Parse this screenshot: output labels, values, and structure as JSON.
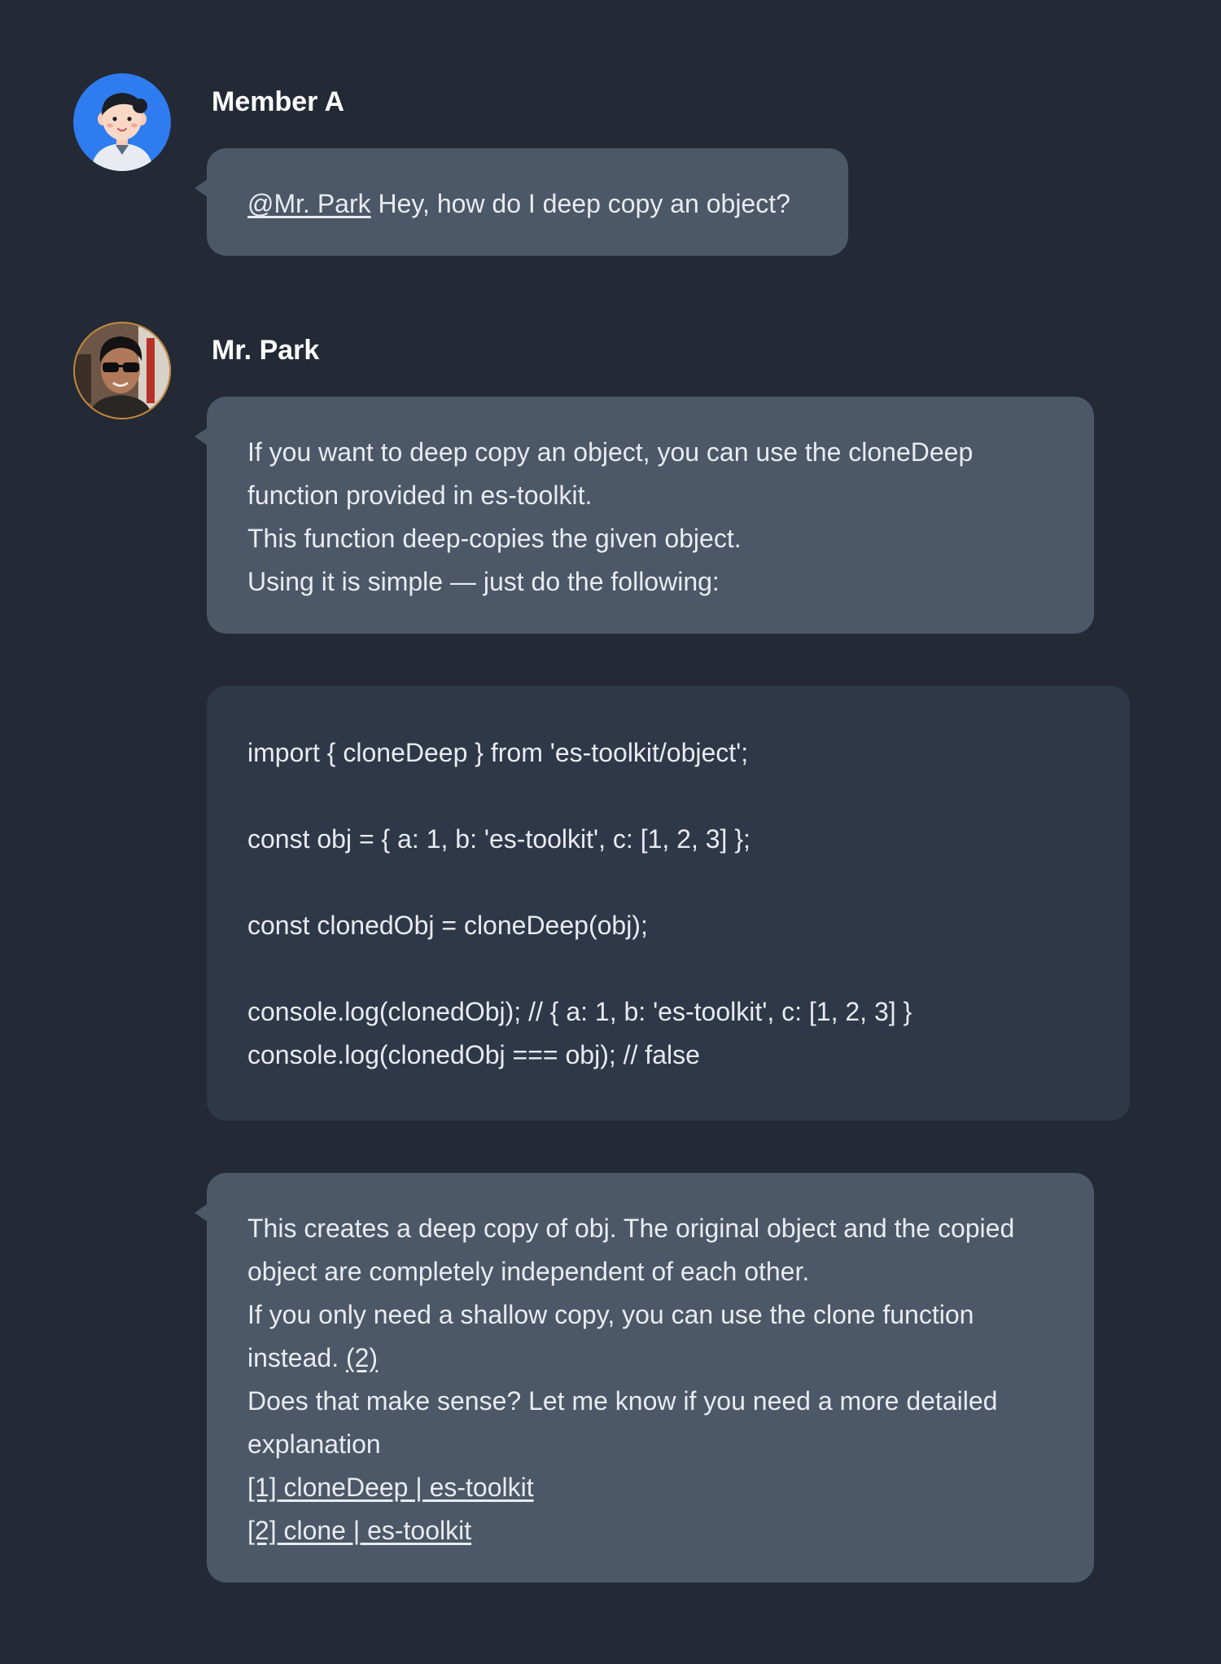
{
  "messages": {
    "first": {
      "sender": "Member A",
      "mention": "@Mr. Park",
      "text": " Hey, how do I deep copy an object?"
    },
    "second": {
      "sender": "Mr. Park",
      "lines": [
        "If you want to deep copy an object, you can use the cloneDeep",
        "function provided in es-toolkit.",
        "This function deep-copies the given object.",
        "Using it is simple — just do the following:"
      ]
    },
    "code": {
      "lines": [
        "import { cloneDeep } from 'es-toolkit/object';",
        "",
        "const obj = { a: 1, b: 'es-toolkit', c: [1, 2, 3] };",
        "",
        "const clonedObj = cloneDeep(obj);",
        "",
        "console.log(clonedObj); // { a: 1, b: 'es-toolkit', c: [1, 2, 3] }",
        "console.log(clonedObj === obj); // false"
      ]
    },
    "third": {
      "line1": "This creates a deep copy of obj. The original object and the copied",
      "line2": "object are completely independent of each other.",
      "line3": "If you only need a shallow copy, you can use the clone function",
      "line4_text": "instead. ",
      "line4_ref": "(2)",
      "line5": "Does that make sense? Let me know if you need a more detailed",
      "line6": "explanation",
      "ref1": "[1] cloneDeep | es-toolkit",
      "ref2": "[2] clone | es-toolkit"
    }
  },
  "colors": {
    "background": "#232a36",
    "bubble": "#4c5767",
    "code_block": "#2e3848",
    "avatar_a_bg": "#2f7cf0",
    "text": "#e8ebf0"
  },
  "icons": {
    "member_a_avatar": "cartoon-person-avatar",
    "mr_park_avatar": "photo-avatar-sunglasses"
  }
}
